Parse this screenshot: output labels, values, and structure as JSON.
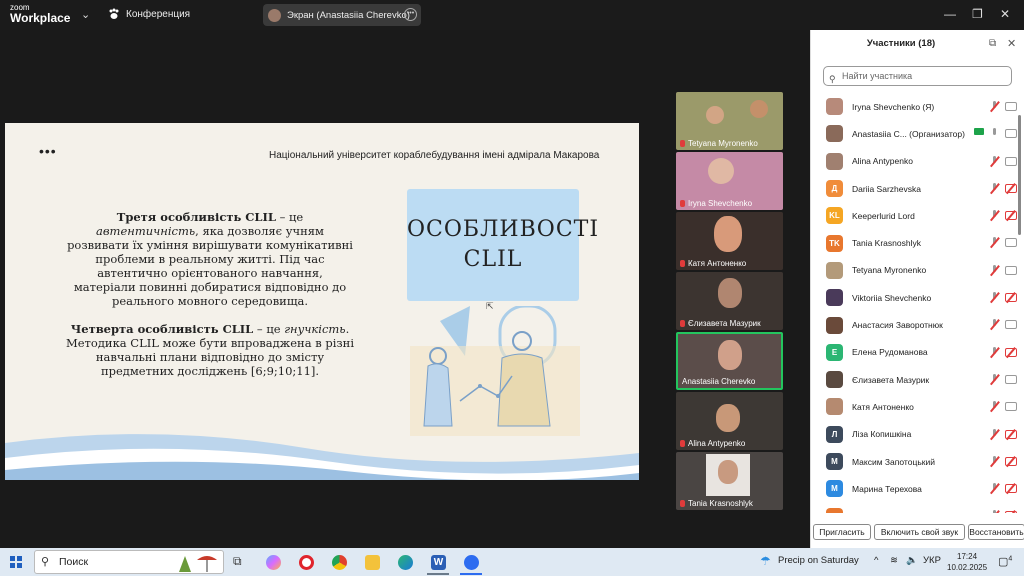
{
  "titlebar": {
    "logo_top": "zoom",
    "logo_bottom": "Workplace",
    "meeting_label": "Конференция",
    "screen_share_label": "Экран (Anastasiia Cherevko)",
    "more_icon": "•••",
    "minimize": "—",
    "restore": "❐",
    "close": "✕"
  },
  "slide": {
    "dots": "•••",
    "university": "Національний університет кораблебудування імені адмірала Макарова",
    "p1_bold": "Третя особливість CLIL",
    "p1_dash": " – це ",
    "p1_italic": "автентичність",
    "p1_rest": ", яка дозволяє учням розвивати їх уміння вирішувати комунікативні проблеми в реальному житті. Під час автентично орієнтованого навчання, матеріали повинні добиратися відповідно до реального мовного середовища.",
    "p2_bold": "Четверта особливість CLIL",
    "p2_dash": " – це ",
    "p2_italic": "гнучкість",
    "p2_rest": ". Методика CLIL може бути впроваджена в різні навчальні плани відповідно до змісту предметних досліджень [6;9;10;11].",
    "title_line1": "ОСОБЛИВОСТІ",
    "title_line2": "CLIL"
  },
  "tiles": [
    {
      "name": "Tetyana Myronenko",
      "bg": "#9b9a6a"
    },
    {
      "name": "Iryna Shevchenko",
      "bg": "#c58aa6"
    },
    {
      "name": "Катя Антоненко",
      "bg": "#3a2f2b"
    },
    {
      "name": "Єлизавета Мазурик",
      "bg": "#3c3430"
    },
    {
      "name": "Anastasiia Cherevko",
      "bg": "#5b4d4a"
    },
    {
      "name": "Alina Antypenko",
      "bg": "#3d3834"
    },
    {
      "name": "Tania Krasnoshlyk",
      "bg": "#4a4543"
    }
  ],
  "panel": {
    "title": "Участники (18)",
    "search_placeholder": "Найти участника",
    "participants": [
      {
        "name": "Iryna Shevchenko (Я)",
        "initials": "",
        "color": "#b78a7a",
        "mic": "muted",
        "cam": "on"
      },
      {
        "name": "Anastasiia C... (Организатор)",
        "initials": "",
        "color": "#8a6a5a",
        "mic": "on",
        "cam": "on"
      },
      {
        "name": "Alina Antypenko",
        "initials": "",
        "color": "#a08070",
        "mic": "muted",
        "cam": "on"
      },
      {
        "name": "Dariia Sarzhevska",
        "initials": "Д",
        "color": "#f08c3a",
        "mic": "muted",
        "cam": "off"
      },
      {
        "name": "Keeperlurid Lord",
        "initials": "KL",
        "color": "#f5a623",
        "mic": "muted",
        "cam": "off"
      },
      {
        "name": "Tania Krasnoshlyk",
        "initials": "TK",
        "color": "#e8772e",
        "mic": "muted",
        "cam": "on"
      },
      {
        "name": "Tetyana Myronenko",
        "initials": "",
        "color": "#b39a7a",
        "mic": "muted",
        "cam": "on"
      },
      {
        "name": "Viktoriia Shevchenko",
        "initials": "",
        "color": "#4a3a5a",
        "mic": "muted",
        "cam": "off"
      },
      {
        "name": "Анастасия Заворотнюк",
        "initials": "",
        "color": "#6a4a3a",
        "mic": "muted",
        "cam": "on"
      },
      {
        "name": "Елена Рудоманова",
        "initials": "Е",
        "color": "#2bb673",
        "mic": "muted",
        "cam": "off"
      },
      {
        "name": "Єлизавета Мазурик",
        "initials": "",
        "color": "#5a4a40",
        "mic": "muted",
        "cam": "on"
      },
      {
        "name": "Катя Антоненко",
        "initials": "",
        "color": "#b58a70",
        "mic": "muted",
        "cam": "on"
      },
      {
        "name": "Ліза Копишкіна",
        "initials": "Л",
        "color": "#3d4a5c",
        "mic": "muted",
        "cam": "off"
      },
      {
        "name": "Максим Запотоцький",
        "initials": "М",
        "color": "#3d4a5c",
        "mic": "muted",
        "cam": "off"
      },
      {
        "name": "Марина Терехова",
        "initials": "М",
        "color": "#2d8ae0",
        "mic": "muted",
        "cam": "off"
      },
      {
        "name": "Оксана Максименко",
        "initials": "О",
        "color": "#e8772e",
        "mic": "muted",
        "cam": "off"
      }
    ],
    "btn_invite": "Пригласить",
    "btn_unmute": "Включить свой звук",
    "btn_restore": "Восстановить"
  },
  "taskbar": {
    "search": "Поиск",
    "weather": "Precip on Saturday",
    "lang": "УКР",
    "time": "17:24",
    "date": "10.02.2025",
    "notif": "4"
  }
}
